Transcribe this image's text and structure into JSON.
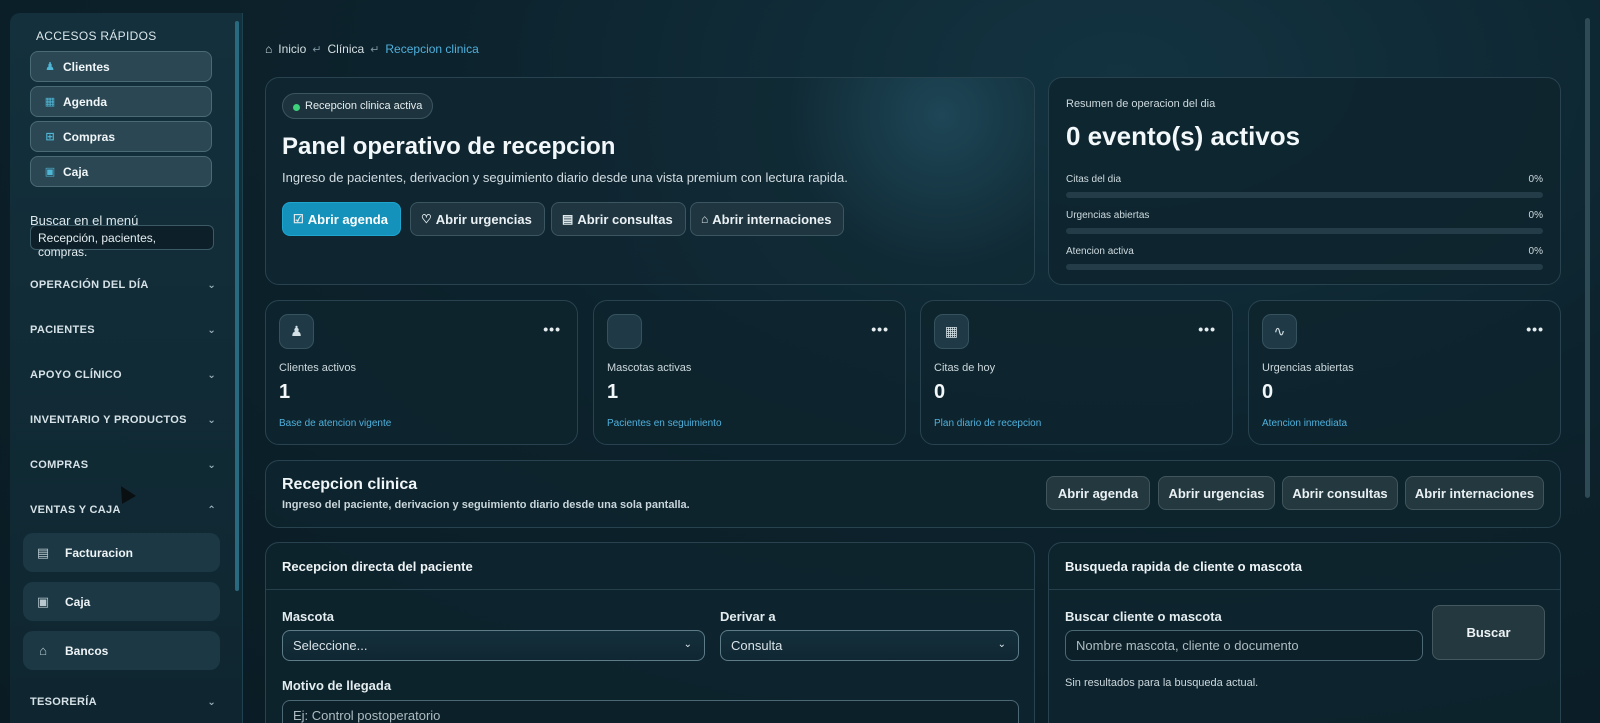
{
  "sidebar": {
    "quick_title": "ACCESOS RÁPIDOS",
    "quick_links": [
      {
        "label": "Clientes",
        "icon": "users-icon"
      },
      {
        "label": "Agenda",
        "icon": "calendar-icon"
      },
      {
        "label": "Compras",
        "icon": "cart-icon"
      },
      {
        "label": "Caja",
        "icon": "cash-icon"
      }
    ],
    "search_label": "Buscar en el menú",
    "search_value": "Recepción, pacientes, compras.",
    "sections": [
      {
        "label": "OPERACIÓN DEL DÍA",
        "expanded": false
      },
      {
        "label": "PACIENTES",
        "expanded": false
      },
      {
        "label": "APOYO CLÍNICO",
        "expanded": false
      },
      {
        "label": "INVENTARIO Y PRODUCTOS",
        "expanded": false
      },
      {
        "label": "COMPRAS",
        "expanded": false
      },
      {
        "label": "VENTAS Y CAJA",
        "expanded": true
      },
      {
        "label": "TESORERÍA",
        "expanded": false
      }
    ],
    "ventas_items": [
      {
        "label": "Facturacion",
        "icon": "invoice-icon"
      },
      {
        "label": "Caja",
        "icon": "cash-register-icon"
      },
      {
        "label": "Bancos",
        "icon": "bank-icon"
      }
    ]
  },
  "breadcrumb": {
    "items": [
      "Inicio",
      "Clínica",
      "Recepcion clinica"
    ]
  },
  "hero": {
    "status_pill": "Recepcion clinica activa",
    "title": "Panel operativo de recepcion",
    "description": "Ingreso de pacientes, derivacion y seguimiento diario desde una vista premium con lectura rapida.",
    "buttons": [
      "Abrir agenda",
      "Abrir urgencias",
      "Abrir consultas",
      "Abrir internaciones"
    ]
  },
  "summary": {
    "label": "Resumen de operacion del dia",
    "headline": "0 evento(s) activos",
    "meters": [
      {
        "label": "Citas del dia",
        "value": "0%",
        "fraction": 0
      },
      {
        "label": "Urgencias abiertas",
        "value": "0%",
        "fraction": 0
      },
      {
        "label": "Atencion activa",
        "value": "0%",
        "fraction": 0
      }
    ]
  },
  "kpis": [
    {
      "label": "Clientes activos",
      "value": "1",
      "sub": "Base de atencion vigente",
      "icon": "users-icon"
    },
    {
      "label": "Mascotas activas",
      "value": "1",
      "sub": "Pacientes en seguimiento",
      "icon": "paw-icon"
    },
    {
      "label": "Citas de hoy",
      "value": "0",
      "sub": "Plan diario de recepcion",
      "icon": "calendar-icon"
    },
    {
      "label": "Urgencias abiertas",
      "value": "0",
      "sub": "Atencion inmediata",
      "icon": "pulse-icon"
    }
  ],
  "kpi_more": "•••",
  "reception": {
    "title": "Recepcion clinica",
    "description": "Ingreso del paciente, derivacion y seguimiento diario desde una sola pantalla.",
    "buttons": [
      "Abrir agenda",
      "Abrir urgencias",
      "Abrir consultas",
      "Abrir internaciones"
    ]
  },
  "direct_form": {
    "title": "Recepcion directa del paciente",
    "mascota_label": "Mascota",
    "mascota_value": "Seleccione...",
    "derivar_label": "Derivar a",
    "derivar_value": "Consulta",
    "motivo_label": "Motivo de llegada",
    "motivo_placeholder": "Ej: Control postoperatorio"
  },
  "quick_search": {
    "title": "Busqueda rapida de cliente o mascota",
    "field_label": "Buscar cliente o mascota",
    "placeholder": "Nombre mascota, cliente o documento",
    "button": "Buscar",
    "empty_text": "Sin resultados para la busqueda actual."
  },
  "colors": {
    "accent": "#1592bb",
    "link": "#4fb0dc",
    "status_ok": "#3ed17c",
    "background": "#0b1c24"
  }
}
